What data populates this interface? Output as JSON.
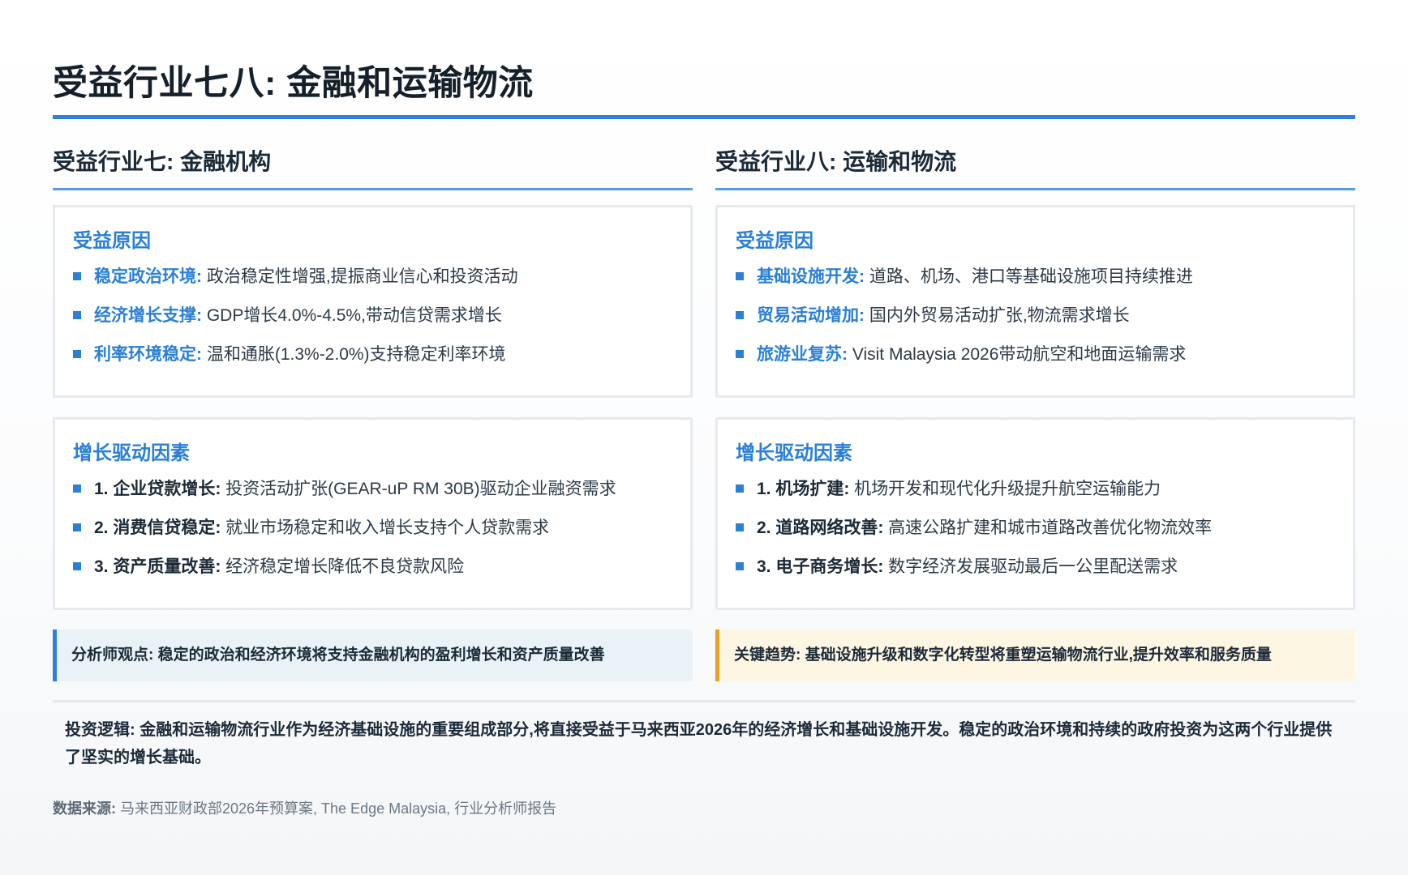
{
  "title": "受益行业七八: 金融和运输物流",
  "left": {
    "heading": "受益行业七: 金融机构",
    "reasons": {
      "title": "受益原因",
      "items": [
        {
          "key": "稳定政治环境:",
          "text": " 政治稳定性增强,提振商业信心和投资活动"
        },
        {
          "key": "经济增长支撑:",
          "text": " GDP增长4.0%-4.5%,带动信贷需求增长"
        },
        {
          "key": "利率环境稳定:",
          "text": " 温和通胀(1.3%-2.0%)支持稳定利率环境"
        }
      ]
    },
    "drivers": {
      "title": "增长驱动因素",
      "items": [
        {
          "key": "1. 企业贷款增长:",
          "text": " 投资活动扩张(GEAR-uP RM 30B)驱动企业融资需求"
        },
        {
          "key": "2. 消费信贷稳定:",
          "text": " 就业市场稳定和收入增长支持个人贷款需求"
        },
        {
          "key": "3. 资产质量改善:",
          "text": " 经济稳定增长降低不良贷款风险"
        }
      ]
    },
    "callout": "分析师观点: 稳定的政治和经济环境将支持金融机构的盈利增长和资产质量改善"
  },
  "right": {
    "heading": "受益行业八: 运输和物流",
    "reasons": {
      "title": "受益原因",
      "items": [
        {
          "key": "基础设施开发:",
          "text": " 道路、机场、港口等基础设施项目持续推进"
        },
        {
          "key": "贸易活动增加:",
          "text": " 国内外贸易活动扩张,物流需求增长"
        },
        {
          "key": "旅游业复苏:",
          "text": " Visit Malaysia 2026带动航空和地面运输需求"
        }
      ]
    },
    "drivers": {
      "title": "增长驱动因素",
      "items": [
        {
          "key": "1. 机场扩建:",
          "text": " 机场开发和现代化升级提升航空运输能力"
        },
        {
          "key": "2. 道路网络改善:",
          "text": " 高速公路扩建和城市道路改善优化物流效率"
        },
        {
          "key": "3. 电子商务增长:",
          "text": " 数字经济发展驱动最后一公里配送需求"
        }
      ]
    },
    "callout": "关键趋势: 基础设施升级和数字化转型将重塑运输物流行业,提升效率和服务质量"
  },
  "investment_logic": "投资逻辑: 金融和运输物流行业作为经济基础设施的重要组成部分,将直接受益于马来西亚2026年的经济增长和基础设施开发。稳定的政治环境和持续的政府投资为这两个行业提供了坚实的增长基础。",
  "source": {
    "label": "数据来源:",
    "text": " 马来西亚财政部2026年预算案, The Edge Malaysia, 行业分析师报告"
  },
  "colors": {
    "accent_blue": "#2a7fd6",
    "rule_blue": "#2f80d8",
    "callout_amber": "#e9a024",
    "callout_blue_bg": "#e9f2f7",
    "callout_amber_bg": "#fdf6e3"
  }
}
